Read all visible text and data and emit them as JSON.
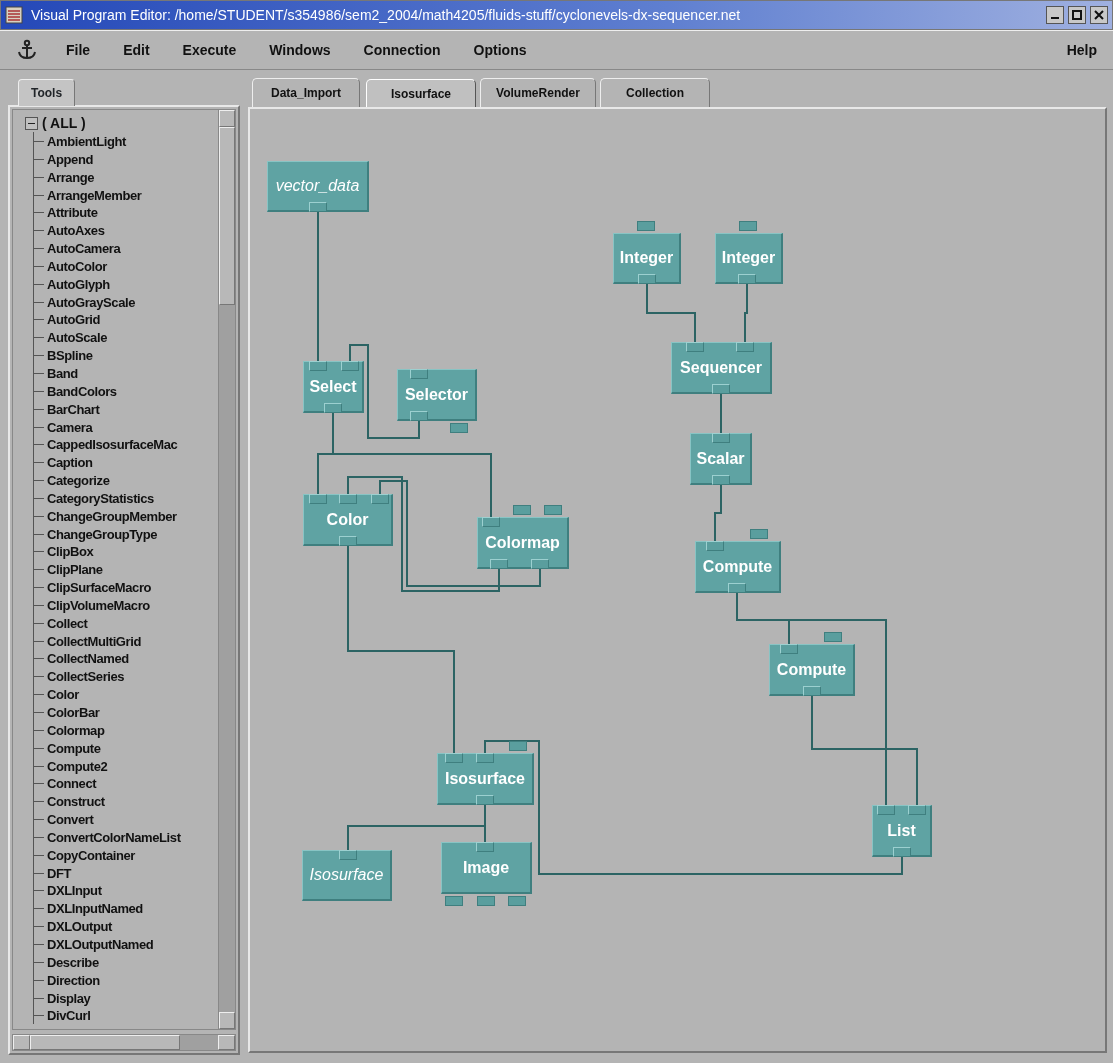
{
  "window": {
    "title": "Visual Program Editor: /home/STUDENT/s354986/sem2_2004/math4205/fluids-stuff/cyclonevels-dx-sequencer.net"
  },
  "menu": {
    "items": [
      "File",
      "Edit",
      "Execute",
      "Windows",
      "Connection",
      "Options"
    ],
    "help": "Help"
  },
  "sidebar": {
    "tabs": [
      {
        "label": "Tools",
        "selected": true
      }
    ],
    "tree": {
      "label": "( ALL )",
      "expanded": true,
      "children": [
        {
          "label": "AmbientLight"
        },
        {
          "label": "Append"
        },
        {
          "label": "Arrange"
        },
        {
          "label": "ArrangeMember"
        },
        {
          "label": "Attribute"
        },
        {
          "label": "AutoAxes"
        },
        {
          "label": "AutoCamera"
        },
        {
          "label": "AutoColor"
        },
        {
          "label": "AutoGlyph"
        },
        {
          "label": "AutoGrayScale"
        },
        {
          "label": "AutoGrid"
        },
        {
          "label": "AutoScale"
        },
        {
          "label": "BSpline"
        },
        {
          "label": "Band"
        },
        {
          "label": "BandColors"
        },
        {
          "label": "BarChart"
        },
        {
          "label": "Camera"
        },
        {
          "label": "CappedIsosurfaceMac"
        },
        {
          "label": "Caption"
        },
        {
          "label": "Categorize"
        },
        {
          "label": "CategoryStatistics"
        },
        {
          "label": "ChangeGroupMember"
        },
        {
          "label": "ChangeGroupType"
        },
        {
          "label": "ClipBox"
        },
        {
          "label": "ClipPlane"
        },
        {
          "label": "ClipSurfaceMacro"
        },
        {
          "label": "ClipVolumeMacro"
        },
        {
          "label": "Collect"
        },
        {
          "label": "CollectMultiGrid"
        },
        {
          "label": "CollectNamed"
        },
        {
          "label": "CollectSeries"
        },
        {
          "label": "Color"
        },
        {
          "label": "ColorBar"
        },
        {
          "label": "Colormap"
        },
        {
          "label": "Compute"
        },
        {
          "label": "Compute2"
        },
        {
          "label": "Connect"
        },
        {
          "label": "Construct"
        },
        {
          "label": "Convert"
        },
        {
          "label": "ConvertColorNameList"
        },
        {
          "label": "CopyContainer"
        },
        {
          "label": "DFT"
        },
        {
          "label": "DXLInput"
        },
        {
          "label": "DXLInputNamed"
        },
        {
          "label": "DXLOutput"
        },
        {
          "label": "DXLOutputNamed"
        },
        {
          "label": "Describe"
        },
        {
          "label": "Direction"
        },
        {
          "label": "Display"
        },
        {
          "label": "DivCurl"
        }
      ]
    }
  },
  "tabs": [
    {
      "label": "Data_Import",
      "selected": false
    },
    {
      "label": "Isosurface",
      "selected": true
    },
    {
      "label": "VolumeRender",
      "selected": false
    },
    {
      "label": "Collection",
      "selected": false
    }
  ],
  "canvas": {
    "nodes": [
      {
        "label": "vector_data",
        "kind": "variable"
      },
      {
        "label": "Select",
        "kind": "module"
      },
      {
        "label": "Selector",
        "kind": "module"
      },
      {
        "label": "Color",
        "kind": "module"
      },
      {
        "label": "Colormap",
        "kind": "module"
      },
      {
        "label": "Integer",
        "kind": "module"
      },
      {
        "label": "Integer",
        "kind": "module"
      },
      {
        "label": "Sequencer",
        "kind": "module"
      },
      {
        "label": "Scalar",
        "kind": "module"
      },
      {
        "label": "Compute",
        "kind": "module"
      },
      {
        "label": "Compute",
        "kind": "module"
      },
      {
        "label": "Isosurface",
        "kind": "module"
      },
      {
        "label": "Isosurface",
        "kind": "variable"
      },
      {
        "label": "Image",
        "kind": "module"
      },
      {
        "label": "List",
        "kind": "module"
      }
    ]
  }
}
